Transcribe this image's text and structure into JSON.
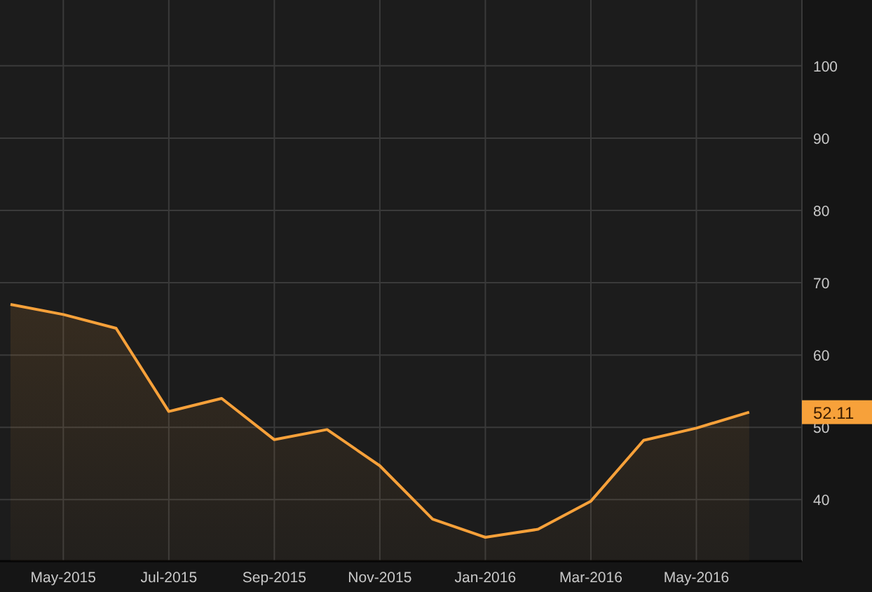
{
  "chart": {
    "chart_data": {
      "type": "area",
      "categories": [
        null,
        "May-2015",
        null,
        "Jul-2015",
        null,
        "Sep-2015",
        null,
        "Nov-2015",
        null,
        "Jan-2016",
        null,
        "Mar-2016",
        null,
        "May-2016",
        null
      ],
      "series": [
        {
          "color": "#f7a13a",
          "values": [
            67.0,
            65.6,
            63.7,
            52.2,
            54.0,
            48.3,
            49.7,
            44.7,
            37.3,
            34.8,
            35.9,
            39.8,
            48.2,
            49.9,
            52.1
          ]
        }
      ],
      "ylim": [
        31.5,
        109.1
      ],
      "grid": true,
      "yticks": [
        40,
        50,
        60,
        70,
        80,
        90,
        100
      ]
    },
    "last_value": "52.11"
  }
}
